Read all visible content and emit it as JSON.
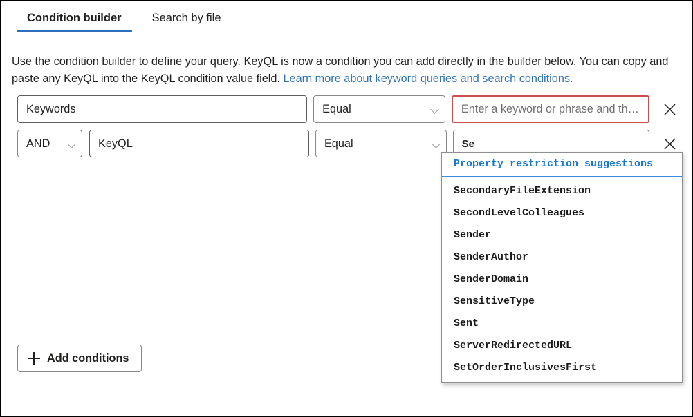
{
  "tabs": [
    {
      "label": "Condition builder",
      "active": true
    },
    {
      "label": "Search by file",
      "active": false
    }
  ],
  "description": {
    "text_before_link": "Use the condition builder to define your query. KeyQL is now a condition you can add directly in the builder below. You can copy and paste any KeyQL into the KeyQL condition value field. ",
    "link_text": "Learn more about keyword queries and search conditions."
  },
  "conditions": [
    {
      "conjunction": null,
      "property": "Keywords",
      "operator": "Equal",
      "value": "",
      "value_placeholder": "Enter a keyword or phrase and th…",
      "value_error": true,
      "remove_label": "✕"
    },
    {
      "conjunction": "AND",
      "property": "KeyQL",
      "operator": "Equal",
      "value": "Se",
      "value_placeholder": "",
      "value_error": false,
      "remove_label": "✕"
    }
  ],
  "add_conditions": {
    "label": "Add conditions",
    "icon": "plus-icon"
  },
  "suggestions": {
    "header": "Property restriction suggestions",
    "items": [
      "SecondaryFileExtension",
      "SecondLevelColleagues",
      "Sender",
      "SenderAuthor",
      "SenderDomain",
      "SensitiveType",
      "Sent",
      "ServerRedirectedURL",
      "SetOrderInclusivesFirst"
    ]
  },
  "colors": {
    "accent": "#2f6ebd",
    "link": "#3273b6",
    "error_border": "#c94f4f",
    "suggest_header": "#1877d2",
    "text": "#201f1e"
  }
}
